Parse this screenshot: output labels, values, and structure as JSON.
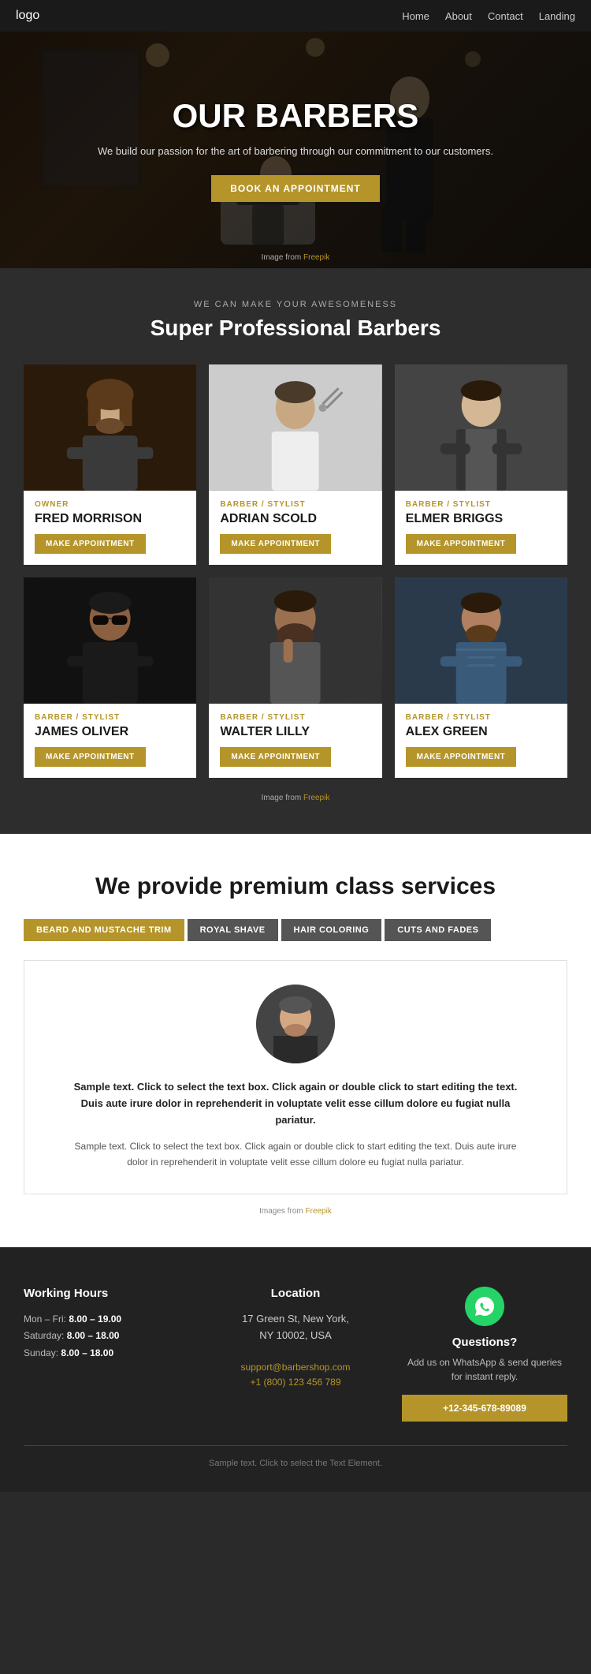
{
  "nav": {
    "logo": "logo",
    "links": [
      "Home",
      "About",
      "Contact",
      "Landing"
    ]
  },
  "hero": {
    "title": "OUR BARBERS",
    "subtitle": "We build our passion for the art of barbering through our commitment to our customers.",
    "cta_label": "BOOK AN APPOINTMENT",
    "credit_text": "Image from ",
    "credit_link": "Freepik"
  },
  "barbers_section": {
    "pretitle": "WE CAN MAKE YOUR AWESOMENESS",
    "title": "Super Professional Barbers",
    "credit_text": "Image from ",
    "credit_link": "Freepik",
    "barbers": [
      {
        "id": "fred",
        "role": "OWNER",
        "name": "FRED MORRISON",
        "btn": "MAKE APPOINTMENT"
      },
      {
        "id": "adrian",
        "role": "BARBER / STYLIST",
        "name": "ADRIAN SCOLD",
        "btn": "MAKE APPOINTMENT"
      },
      {
        "id": "elmer",
        "role": "BARBER / STYLIST",
        "name": "ELMER BRIGGS",
        "btn": "MAKE APPOINTMENT"
      },
      {
        "id": "james",
        "role": "BARBER / STYLIST",
        "name": "JAMES OLIVER",
        "btn": "MAKE APPOINTMENT"
      },
      {
        "id": "walter",
        "role": "BARBER / STYLIST",
        "name": "WALTER LILLY",
        "btn": "MAKE APPOINTMENT"
      },
      {
        "id": "alex",
        "role": "BARBER / STYLIST",
        "name": "ALEX GREEN",
        "btn": "MAKE APPOINTMENT"
      }
    ]
  },
  "services_section": {
    "title": "We provide premium class services",
    "tabs": [
      {
        "id": "beard",
        "label": "BEARD AND MUSTACHE TRIM",
        "active": true
      },
      {
        "id": "shave",
        "label": "ROYAL SHAVE",
        "active": false
      },
      {
        "id": "coloring",
        "label": "HAIR COLORING",
        "active": false
      },
      {
        "id": "cuts",
        "label": "CUTS AND FADES",
        "active": false
      }
    ],
    "content_main": "Sample text. Click to select the text box. Click again or double click to start editing the text. Duis aute irure dolor in reprehenderit in voluptate velit esse cillum dolore eu fugiat nulla pariatur.",
    "content_sub": "Sample text. Click to select the text box. Click again or double click to start editing the text. Duis aute irure dolor in reprehenderit in voluptate velit esse cillum dolore eu fugiat nulla pariatur.",
    "credit_text": "Images from ",
    "credit_link": "Freepik"
  },
  "footer": {
    "hours_title": "Working Hours",
    "hours": [
      {
        "day": "Mon – Fri:",
        "time": "8.00 – 19.00"
      },
      {
        "day": "Saturday:",
        "time": "8.00 – 18.00"
      },
      {
        "day": "Sunday:",
        "time": "8.00 – 18.00"
      }
    ],
    "location_title": "Location",
    "address_line1": "17 Green St, New York,",
    "address_line2": "NY 10002, USA",
    "email": "support@barbershop.com",
    "phone": "+1 (800) 123 456 789",
    "questions_title": "Questions?",
    "questions_text": "Add us on WhatsApp & send queries for instant reply.",
    "wa_btn": "+12-345-678-89089",
    "bottom_text": "Sample text. Click to select the Text Element."
  }
}
